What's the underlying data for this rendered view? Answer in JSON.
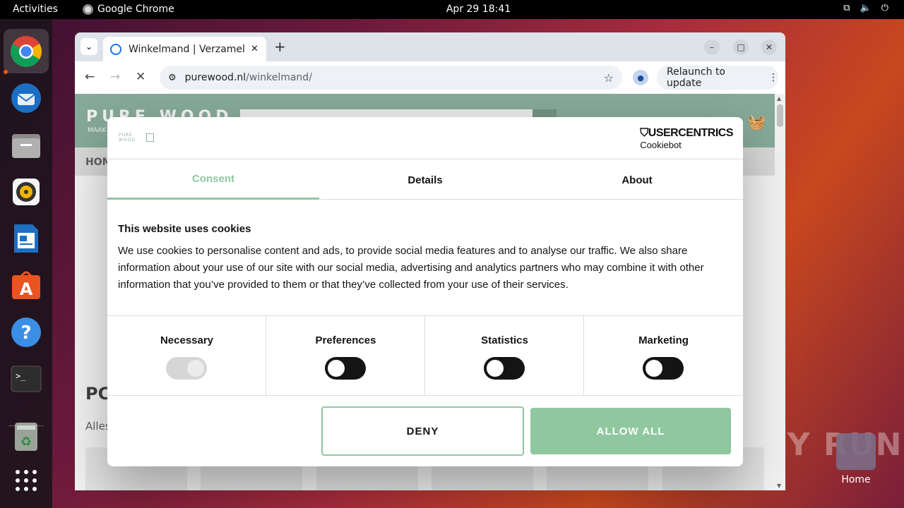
{
  "topbar": {
    "activities": "Activities",
    "app_name": "Google Chrome",
    "clock": "Apr 29  18:41",
    "tray_icons": [
      "network-icon",
      "volume-icon",
      "power-icon"
    ]
  },
  "dock": {
    "items": [
      "chrome-icon",
      "thunderbird-icon",
      "files-icon",
      "rhythmbox-icon",
      "writer-icon",
      "app-center-icon",
      "help-icon",
      "terminal-icon",
      "trash-icon",
      "show-apps-icon"
    ]
  },
  "desktop": {
    "home_label": "Home",
    "watermark": "ANY RUN"
  },
  "browser": {
    "tab_title": "Winkelmand | Verzamel je",
    "tab_close": "✕",
    "new_tab": "+",
    "url_host": "purewood.nl",
    "url_path": "/winkelmand/",
    "relaunch_label": "Relaunch to update",
    "window_controls": {
      "minimize": "–",
      "maximize": "□",
      "close": "✕"
    }
  },
  "site": {
    "brand": "PURE WOOD",
    "brand_sub": "MAAK",
    "nav_home": "HOM",
    "heading": "PC",
    "subtext": "Alles"
  },
  "cookie": {
    "provider_line1": "USERCENTRICS",
    "provider_line2": "Cookiebot",
    "logo_text": "PURE WOOD",
    "tabs": [
      "Consent",
      "Details",
      "About"
    ],
    "active_tab": "Consent",
    "title": "This website uses cookies",
    "body": "We use cookies to personalise content and ads, to provide social media features and to analyse our traffic. We also share information about your use of our site with our social media, advertising and analytics partners who may combine it with other information that you’ve provided to them or that they’ve collected from your use of their services.",
    "categories": [
      {
        "label": "Necessary",
        "enabled": true,
        "locked": true
      },
      {
        "label": "Preferences",
        "enabled": false,
        "locked": false
      },
      {
        "label": "Statistics",
        "enabled": false,
        "locked": false
      },
      {
        "label": "Marketing",
        "enabled": false,
        "locked": false
      }
    ],
    "deny_label": "DENY",
    "allow_label": "ALLOW ALL",
    "accent_color": "#8fc79e"
  }
}
